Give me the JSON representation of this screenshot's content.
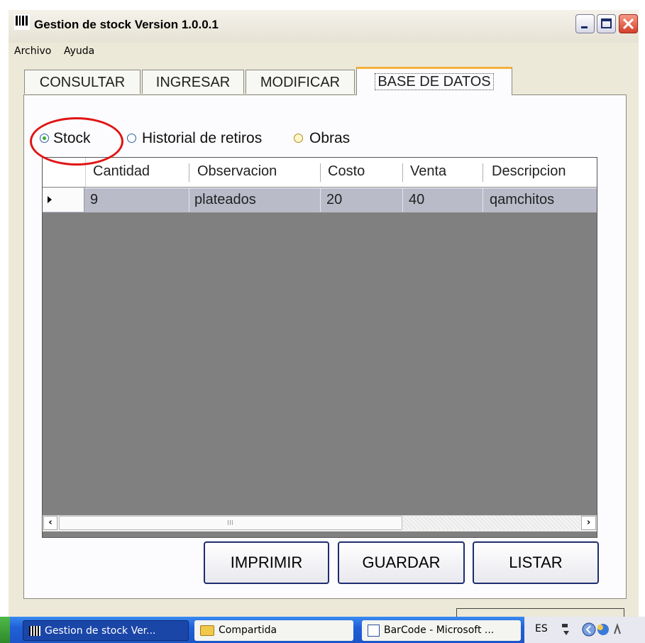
{
  "window": {
    "title": "Gestion de stock Version 1.0.0.1"
  },
  "menu": [
    "Archivo",
    "Ayuda"
  ],
  "tabs": [
    "CONSULTAR",
    "INGRESAR",
    "MODIFICAR",
    "BASE DE DATOS"
  ],
  "active_tab": "BASE DE DATOS",
  "radios": [
    {
      "label": "Stock",
      "checked": true
    },
    {
      "label": "Historial de retiros",
      "checked": false
    },
    {
      "label": "Obras",
      "checked": false
    }
  ],
  "grid": {
    "columns": [
      "Cantidad",
      "Observacion",
      "Costo",
      "Venta",
      "Descripcion"
    ],
    "rows": [
      [
        "9",
        "plateados",
        "20",
        "40",
        "qamchitos"
      ]
    ]
  },
  "scrollbar": {
    "grip": "III"
  },
  "buttons": {
    "imprimir": "IMPRIMIR",
    "guardar": "GUARDAR",
    "listar": "LISTAR"
  },
  "taskbar": {
    "items": [
      "Gestion de stock Ver...",
      "Compartida",
      "BarCode - Microsoft ..."
    ],
    "tray_lang": "ES"
  },
  "colors": {
    "highlight": "#e01414",
    "tab_accent": "#f5b13c",
    "grid_bg": "#808080",
    "selected_row": "#b9bbc9"
  }
}
